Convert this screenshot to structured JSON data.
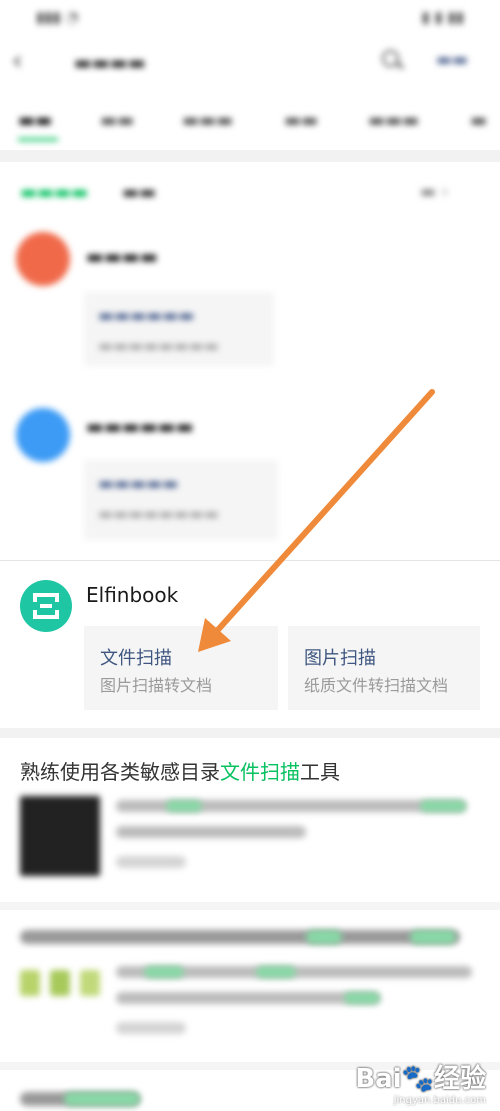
{
  "mini_program": {
    "name": "Elfinbook",
    "icon": "scan-frame-icon",
    "icon_color": "#1fc6a4",
    "cards": [
      {
        "title": "文件扫描",
        "subtitle": "图片扫描转文档"
      },
      {
        "title": "图片扫描",
        "subtitle": "纸质文件转扫描文档"
      }
    ]
  },
  "article": {
    "title_prefix": "熟练使用各类敏感目录",
    "title_highlight": "文件扫描",
    "title_suffix": "工具"
  },
  "colors": {
    "accent_green": "#07c160",
    "link_blue": "#576b95",
    "arrow_orange": "#ef8a3a"
  }
}
